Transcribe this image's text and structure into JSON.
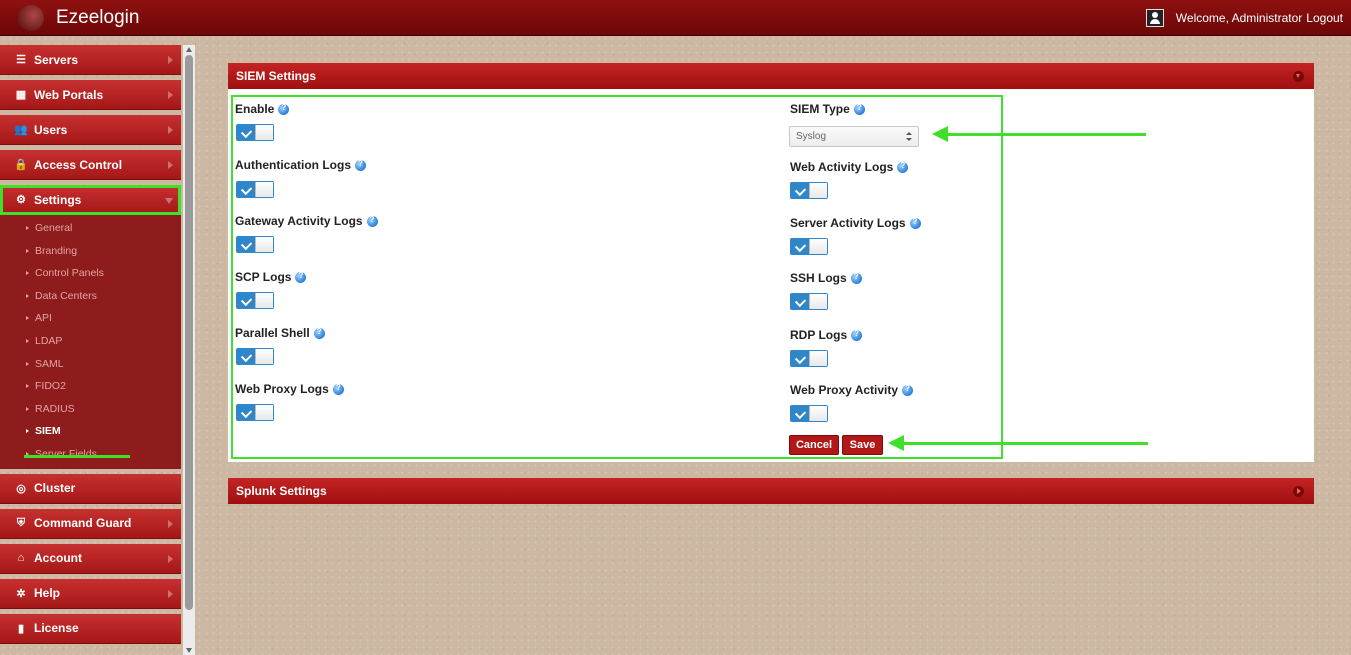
{
  "app": {
    "title": "Ezeelogin",
    "welcome": "Welcome, Administrator",
    "logout": "Logout"
  },
  "sidebar": {
    "items": [
      {
        "label": "Servers",
        "icon": "list-icon"
      },
      {
        "label": "Web Portals",
        "icon": "grid-icon"
      },
      {
        "label": "Users",
        "icon": "users-icon"
      },
      {
        "label": "Access Control",
        "icon": "lock-icon"
      },
      {
        "label": "Settings",
        "icon": "gears-icon"
      }
    ],
    "submenu": [
      "General",
      "Branding",
      "Control Panels",
      "Data Centers",
      "API",
      "LDAP",
      "SAML",
      "FIDO2",
      "RADIUS",
      "SIEM",
      "Server Fields"
    ],
    "items_after": [
      {
        "label": "Cluster",
        "icon": "dribbble-icon"
      },
      {
        "label": "Command Guard",
        "icon": "shield-icon"
      },
      {
        "label": "Account",
        "icon": "home-icon"
      },
      {
        "label": "Help",
        "icon": "lifebuoy-icon"
      },
      {
        "label": "License",
        "icon": "file-icon"
      }
    ]
  },
  "siem": {
    "title": "SIEM Settings",
    "left_fields": [
      "Enable",
      "Authentication Logs",
      "Gateway Activity Logs",
      "SCP Logs",
      "Parallel Shell",
      "Web Proxy Logs"
    ],
    "right_fields": [
      "Web Activity Logs",
      "Server Activity Logs",
      "SSH Logs",
      "RDP Logs",
      "Web Proxy Activity"
    ],
    "type_label": "SIEM Type",
    "type_value": "Syslog",
    "cancel": "Cancel",
    "save": "Save"
  },
  "splunk": {
    "title": "Splunk Settings"
  }
}
